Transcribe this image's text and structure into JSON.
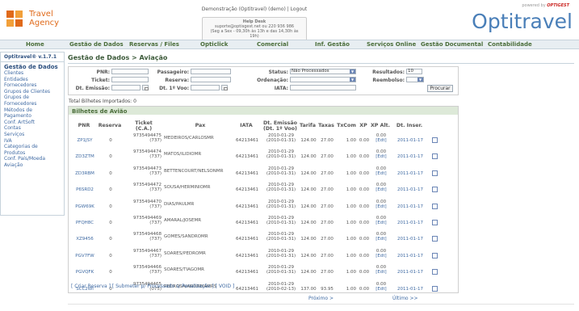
{
  "header": {
    "logo_line1": "Travel",
    "logo_line2": "Agency",
    "user_links": "Demonstração (Optitravel) (demo) | Logout",
    "helpdesk_title": "Help Desk",
    "helpdesk_contact": "suporte@optisgest.net ou 220 936 986",
    "helpdesk_hours": "(Seg a Sex - 09,30h às 13h e das 14,30h às 19h)",
    "powered_by": "powered by",
    "powered_brand": "OPTIGEST",
    "brand": "Optitravel"
  },
  "nav": {
    "home": "Home",
    "gestao_dados": "Gestão de Dados",
    "reservas": "Reservas / Files",
    "opticlick": "Opticlick",
    "comercial": "Comercial",
    "inf_gestao": "Inf. Gestão",
    "servicos_online": "Serviços Online",
    "gestao_documental": "Gestão Documental",
    "contabilidade": "Contabilidade"
  },
  "sidebar": {
    "version": "Optitravel® v.1.7.1",
    "title": "Gestão de Dados",
    "items": [
      "Clientes",
      "Entidades",
      "Fornecedores",
      "Grupos de Clientes",
      "Grupos de",
      "Fornecedores",
      "Métodos de",
      "Pagamento",
      "Conf. ArtSoft",
      "Contas",
      "Serviços",
      "IVA",
      "Categorias de",
      "Produtos",
      "Conf. País/Moeda",
      "Aviação"
    ]
  },
  "page": {
    "breadcrumb": "Gestão de Dados > Aviação",
    "imported_label": "Total Bilhetes Importados: 0",
    "table_title": "Bilhetes de Avião"
  },
  "filters": {
    "pnr_label": "PNR:",
    "ticket_label": "Ticket:",
    "dt_emissao_label": "Dt. Emissão:",
    "passageiro_label": "Passageiro:",
    "reserva_label": "Reserva:",
    "dt_voo_label": "Dt. 1º Voo:",
    "status_label": "Status:",
    "status_value": "Não Processados",
    "ordenacao_label": "Ordenação:",
    "iata_label": "IATA:",
    "resultados_label": "Resultados:",
    "resultados_value": "10",
    "reembolso_label": "Reembolso:",
    "search_button": "Procurar"
  },
  "table": {
    "headers": {
      "pnr": "PNR",
      "reserva": "Reserva",
      "ticket_1": "Ticket",
      "ticket_2": "(C.A.)",
      "pax": "Pax",
      "iata": "IATA",
      "dt_emissao_1": "Dt. Emissão",
      "dt_emissao_2": "(Dt. 1º Voo)",
      "tarifa": "Tarifa",
      "taxas": "Taxas",
      "txcom": "TxCom",
      "xp": "XP",
      "xpalt": "XP Alt.",
      "dt_inser": "Dt. Inser."
    },
    "rows": [
      {
        "pnr": "ZP1JSY",
        "reserva": "0",
        "ticket": "9735494475",
        "ca": "(737)",
        "pax": "MEDEIROS/CARLOSMR",
        "iata": "64213461",
        "dt_emissao": "2010-01-29",
        "dt_voo": "(2010-01-31)",
        "tarifa": "124.00",
        "taxas": "27.00",
        "txcom": "1.00",
        "xp": "0.00",
        "xpalt": "0.00",
        "edit": "[Edt]",
        "dt_inser": "2011-01-17"
      },
      {
        "pnr": "ZD3ZTM",
        "reserva": "0",
        "ticket": "9735494474",
        "ca": "(737)",
        "pax": "MATOS/ILIDIOMR",
        "iata": "64213461",
        "dt_emissao": "2010-01-29",
        "dt_voo": "(2010-01-31)",
        "tarifa": "124.00",
        "taxas": "27.00",
        "txcom": "1.00",
        "xp": "0.00",
        "xpalt": "0.00",
        "edit": "[Edt]",
        "dt_inser": "2011-01-17"
      },
      {
        "pnr": "ZD3RBM",
        "reserva": "0",
        "ticket": "9735494473",
        "ca": "(737)",
        "pax": "BETTENCOURT/NELSONMR",
        "iata": "64213461",
        "dt_emissao": "2010-01-29",
        "dt_voo": "(2010-01-31)",
        "tarifa": "124.00",
        "taxas": "27.00",
        "txcom": "1.00",
        "xp": "0.00",
        "xpalt": "0.00",
        "edit": "[Edt]",
        "dt_inser": "2011-01-17"
      },
      {
        "pnr": "P6SRD2",
        "reserva": "0",
        "ticket": "9735494472",
        "ca": "(737)",
        "pax": "SOUSA/HERMINIOMR",
        "iata": "64213461",
        "dt_emissao": "2010-01-29",
        "dt_voo": "(2010-01-31)",
        "tarifa": "124.00",
        "taxas": "27.00",
        "txcom": "1.00",
        "xp": "0.00",
        "xpalt": "0.00",
        "edit": "[Edt]",
        "dt_inser": "2011-01-17"
      },
      {
        "pnr": "PGW69K",
        "reserva": "0",
        "ticket": "9735494470",
        "ca": "(737)",
        "pax": "DIAS/PAULMR",
        "iata": "64213461",
        "dt_emissao": "2010-01-29",
        "dt_voo": "(2010-01-31)",
        "tarifa": "124.00",
        "taxas": "27.00",
        "txcom": "1.00",
        "xp": "0.00",
        "xpalt": "0.00",
        "edit": "[Edt]",
        "dt_inser": "2011-01-17"
      },
      {
        "pnr": "PFQH8C",
        "reserva": "0",
        "ticket": "9735494469",
        "ca": "(737)",
        "pax": "AMARAL/JOSEMR",
        "iata": "64213461",
        "dt_emissao": "2010-01-29",
        "dt_voo": "(2010-01-31)",
        "tarifa": "124.00",
        "taxas": "27.00",
        "txcom": "1.00",
        "xp": "0.00",
        "xpalt": "0.00",
        "edit": "[Edt]",
        "dt_inser": "2011-01-17"
      },
      {
        "pnr": "XZ9456",
        "reserva": "0",
        "ticket": "9735494468",
        "ca": "(737)",
        "pax": "GOMES/SANDROMR",
        "iata": "64213461",
        "dt_emissao": "2010-01-29",
        "dt_voo": "(2010-01-31)",
        "tarifa": "124.00",
        "taxas": "27.00",
        "txcom": "1.00",
        "xp": "0.00",
        "xpalt": "0.00",
        "edit": "[Edt]",
        "dt_inser": "2011-01-17"
      },
      {
        "pnr": "PGV7FW",
        "reserva": "0",
        "ticket": "9735494467",
        "ca": "(737)",
        "pax": "SOARES/PEDROMR",
        "iata": "64213461",
        "dt_emissao": "2010-01-29",
        "dt_voo": "(2010-01-31)",
        "tarifa": "124.00",
        "taxas": "27.00",
        "txcom": "1.00",
        "xp": "0.00",
        "xpalt": "0.00",
        "edit": "[Edt]",
        "dt_inser": "2011-01-17"
      },
      {
        "pnr": "PGVQFK",
        "reserva": "0",
        "ticket": "9735494466",
        "ca": "(737)",
        "pax": "SOARES/TIAGOMR",
        "iata": "64213461",
        "dt_emissao": "2010-01-29",
        "dt_voo": "(2010-01-31)",
        "tarifa": "124.00",
        "taxas": "27.00",
        "txcom": "1.00",
        "xp": "0.00",
        "xpalt": "0.00",
        "edit": "[Edt]",
        "dt_inser": "2011-01-17"
      },
      {
        "pnr": "SCC2WI",
        "reserva": "0",
        "ticket": "9735494465",
        "ca": "(075)",
        "pax": "PEDROSA/ANDREIAMRS",
        "iata": "64213461",
        "dt_emissao": "2010-01-29",
        "dt_voo": "(2010-02-13)",
        "tarifa": "137.00",
        "taxas": "93.95",
        "txcom": "1.00",
        "xp": "0.00",
        "xpalt": "0.00",
        "edit": "[Edt]",
        "dt_inser": "2011-01-17"
      }
    ]
  },
  "actions": {
    "links": "[ Criar Reserva ] [ Submeter p/ Processado s/ Penalização ] [ VOID ]",
    "next": "Próximo >",
    "last": "Último >>"
  },
  "colors": {
    "brand_blue": "#4a7fb8",
    "nav_green": "#4a6d3a",
    "link_blue": "#3f6aa3",
    "logo_orange": "#e06a1a"
  }
}
